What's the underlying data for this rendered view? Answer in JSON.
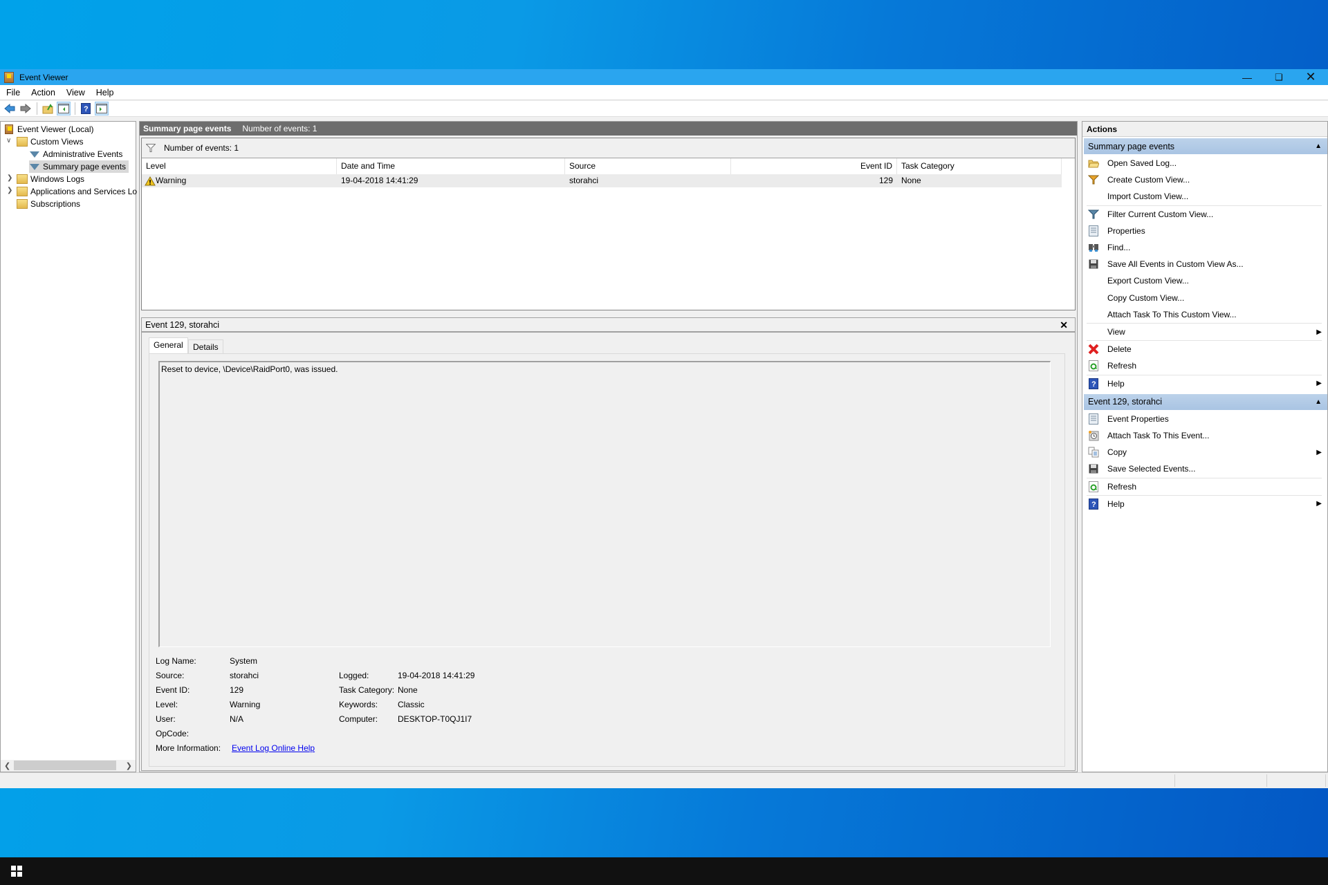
{
  "window": {
    "title": "Event Viewer",
    "controls": [
      "minimize",
      "restore",
      "close"
    ]
  },
  "menubar": [
    "File",
    "Action",
    "View",
    "Help"
  ],
  "toolbar": [
    {
      "icon": "back-arrow-icon"
    },
    {
      "icon": "forward-arrow-icon"
    },
    {
      "icon": "up-folder-icon"
    },
    {
      "icon": "show-hide-console-tree-icon"
    },
    {
      "icon": "help-icon"
    },
    {
      "icon": "show-hide-action-pane-icon"
    }
  ],
  "tree": {
    "root": "Event Viewer (Local)",
    "items": [
      {
        "label": "Custom Views",
        "expanded": true
      },
      {
        "label": "Administrative Events"
      },
      {
        "label": "Summary page events",
        "selected": true
      },
      {
        "label": "Windows Logs",
        "expanded": false
      },
      {
        "label": "Applications and Services Lo",
        "expanded": false
      },
      {
        "label": "Subscriptions"
      }
    ]
  },
  "middle": {
    "header_title": "Summary page events",
    "header_count": "Number of events: 1",
    "filter_count": "Number of events: 1",
    "columns": [
      "Level",
      "Date and Time",
      "Source",
      "Event ID",
      "Task Category"
    ],
    "rows": [
      {
        "level": "Warning",
        "datetime": "19-04-2018 14:41:29",
        "source": "storahci",
        "event_id": "129",
        "task_category": "None"
      }
    ]
  },
  "detail": {
    "title": "Event 129, storahci",
    "tabs": [
      "General",
      "Details"
    ],
    "active_tab": "General",
    "message": "Reset to device, \\Device\\RaidPort0, was issued.",
    "fields": {
      "log_name_label": "Log Name:",
      "log_name": "System",
      "source_label": "Source:",
      "source": "storahci",
      "event_id_label": "Event ID:",
      "event_id": "129",
      "level_label": "Level:",
      "level": "Warning",
      "user_label": "User:",
      "user": "N/A",
      "opcode_label": "OpCode:",
      "opcode": "",
      "more_info_label": "More Information:",
      "more_info_link": "Event Log Online Help",
      "logged_label": "Logged:",
      "logged": "19-04-2018 14:41:29",
      "task_category_label": "Task Category:",
      "task_category": "None",
      "keywords_label": "Keywords:",
      "keywords": "Classic",
      "computer_label": "Computer:",
      "computer": "DESKTOP-T0QJ1I7"
    }
  },
  "actions": {
    "title": "Actions",
    "groups": [
      {
        "title": "Summary page events",
        "items": [
          {
            "label": "Open Saved Log...",
            "icon": "open-folder-icon"
          },
          {
            "label": "Create Custom View...",
            "icon": "create-filter-icon"
          },
          {
            "label": "Import Custom View...",
            "icon": ""
          },
          {
            "label": "Filter Current Custom View...",
            "icon": "filter-icon"
          },
          {
            "label": "Properties",
            "icon": "properties-icon"
          },
          {
            "label": "Find...",
            "icon": "binoculars-icon"
          },
          {
            "label": "Save All Events in Custom View As...",
            "icon": "save-disk-icon"
          },
          {
            "label": "Export Custom View...",
            "icon": ""
          },
          {
            "label": "Copy Custom View...",
            "icon": ""
          },
          {
            "label": "Attach Task To This Custom View...",
            "icon": ""
          },
          {
            "label": "View",
            "icon": "",
            "submenu": true
          },
          {
            "label": "Delete",
            "icon": "delete-x-icon"
          },
          {
            "label": "Refresh",
            "icon": "refresh-icon"
          },
          {
            "label": "Help",
            "icon": "help-icon",
            "submenu": true
          }
        ]
      },
      {
        "title": "Event 129, storahci",
        "items": [
          {
            "label": "Event Properties",
            "icon": "properties-icon"
          },
          {
            "label": "Attach Task To This Event...",
            "icon": "task-clock-icon"
          },
          {
            "label": "Copy",
            "icon": "copy-icon",
            "submenu": true
          },
          {
            "label": "Save Selected Events...",
            "icon": "save-disk-icon"
          },
          {
            "label": "Refresh",
            "icon": "refresh-icon"
          },
          {
            "label": "Help",
            "icon": "help-icon",
            "submenu": true
          }
        ]
      }
    ]
  },
  "colors": {
    "titlebar": "#2aa5ef",
    "pane_header": "#6d6d6d",
    "action_group": "#bcd2ea",
    "link": "#0000ee",
    "taskbar": "#111111"
  }
}
